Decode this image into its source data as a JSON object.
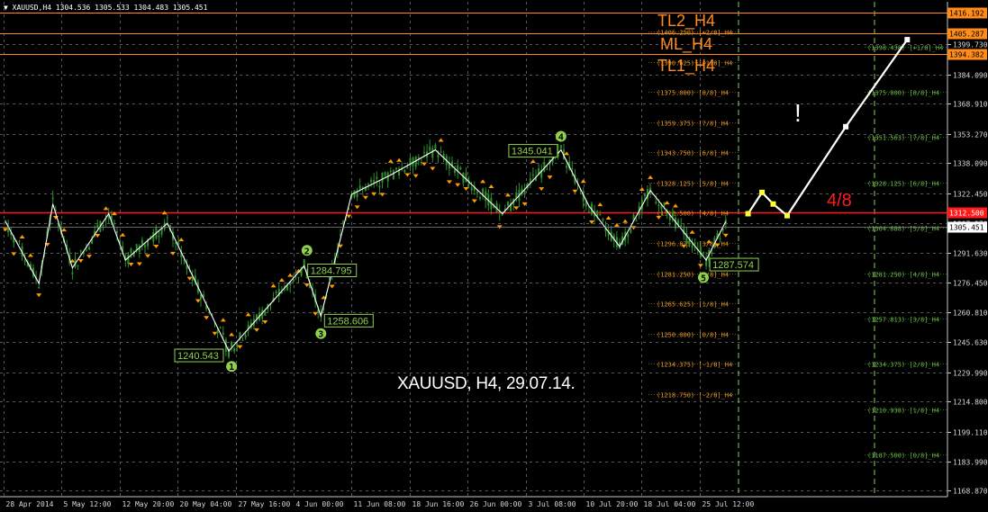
{
  "header": {
    "collapse_glyph": "▼",
    "symbol_line": "XAUUSD,H4  1304.536 1305.533 1304.483 1305.451"
  },
  "caption": "XAUUSD, H4, 29.07.14.",
  "annotations": {
    "exclamation": "!",
    "four_eighths": "4/8",
    "tl2": "TL2_H4",
    "ml": "ML_H4",
    "tl1": "TL1_H4"
  },
  "colors": {
    "background": "#000000",
    "grid": "#5a5a5a",
    "candles": "#2f8f2f",
    "zigzag": "#ffffff",
    "fractals": "#ff9900",
    "level_red": "#ff1a1a",
    "level_orange": "#ff8c1a",
    "wave_labels": "#8fd14f",
    "murrey_orange": "#e89a2a",
    "murrey_green": "#6abf47"
  },
  "chart_data": {
    "type": "candlestick",
    "symbol": "XAUUSD",
    "timeframe": "H4",
    "ylim": [
      1164.0,
      1420.0
    ],
    "price_ticks": [
      1168.87,
      1183.99,
      1199.11,
      1214.8,
      1229.99,
      1245.63,
      1260.81,
      1276.45,
      1291.63,
      1307.27,
      1322.45,
      1338.09,
      1353.27,
      1368.91,
      1384.09,
      1399.73
    ],
    "time_labels": [
      "28 Apr 2014",
      "5 May 12:00",
      "12 May 20:00",
      "20 May 04:00",
      "27 May 16:00",
      "4 Jun 00:00",
      "11 Jun 08:00",
      "18 Jun 16:00",
      "26 Jun 00:00",
      "3 Jul 08:00",
      "10 Jul 20:00",
      "18 Jul 04:00",
      "25 Jul 12:00"
    ],
    "current_price": {
      "value": 1305.451,
      "label": "1305.451"
    },
    "horizontal_levels": [
      {
        "name": "TL2_H4",
        "value": 1416.192,
        "label": "1416.192",
        "color": "#ff8c1a"
      },
      {
        "name": "ML_H4",
        "value": 1405.287,
        "label": "1405.287",
        "color": "#ff8c1a"
      },
      {
        "name": "TL1_H4",
        "value": 1394.382,
        "label": "1394.382",
        "color": "#ff8c1a"
      },
      {
        "name": "4/8",
        "value": 1312.5,
        "label": "1312.500",
        "color": "#ff1a1a"
      }
    ],
    "murrey_orange_levels": [
      {
        "value": 1406.25,
        "label": "(1406.250) [+2/8]_H4"
      },
      {
        "value": 1390.625,
        "label": "(1390.625) [+1/8]_H4"
      },
      {
        "value": 1375.0,
        "label": "(1375.000) [8/8]_H4"
      },
      {
        "value": 1359.375,
        "label": "(1359.375) [7/8]_H4"
      },
      {
        "value": 1343.75,
        "label": "(1343.750) [6/8]_H4"
      },
      {
        "value": 1328.125,
        "label": "(1328.125) [5/8]_H4"
      },
      {
        "value": 1312.5,
        "label": "(1312.500) [4/8]_H4"
      },
      {
        "value": 1296.875,
        "label": "(1296.875) [3/8]_H4"
      },
      {
        "value": 1281.25,
        "label": "(1281.250) [2/8]_H4"
      },
      {
        "value": 1265.625,
        "label": "(1265.625) [1/8]_H4"
      },
      {
        "value": 1250.0,
        "label": "(1250.000) [0/8]_H4"
      },
      {
        "value": 1234.375,
        "label": "(1234.375) [-1/8]_H4"
      },
      {
        "value": 1218.75,
        "label": "(1218.750) [-2/8]_H4"
      }
    ],
    "murrey_green_levels": [
      {
        "value": 1398.438,
        "label": "(1398.438) [+1/8]_H4"
      },
      {
        "value": 1375.0,
        "label": "(1375.000) [8/8]_H4"
      },
      {
        "value": 1351.563,
        "label": "(1351.563) [7/8]_H4"
      },
      {
        "value": 1328.125,
        "label": "(1328.125) [6/8]_H4"
      },
      {
        "value": 1304.688,
        "label": "(1304.688) [5/8]_H4"
      },
      {
        "value": 1281.25,
        "label": "(1281.250) [4/8]_H4"
      },
      {
        "value": 1257.813,
        "label": "(1257.813) [3/8]_H4"
      },
      {
        "value": 1234.375,
        "label": "(1234.375) [2/8]_H4"
      },
      {
        "value": 1210.938,
        "label": "(1210.938) [1/8]_H4"
      },
      {
        "value": 1187.5,
        "label": "(1187.500) [0/8]_H4"
      }
    ],
    "zigzag": [
      {
        "t": 0.0,
        "y": 1308
      },
      {
        "t": 12,
        "y": 1276
      },
      {
        "t": 17,
        "y": 1317
      },
      {
        "t": 24,
        "y": 1284
      },
      {
        "t": 37,
        "y": 1312
      },
      {
        "t": 43,
        "y": 1288
      },
      {
        "t": 58,
        "y": 1307
      },
      {
        "t": 80,
        "y": 1241
      },
      {
        "t": 107,
        "y": 1285
      },
      {
        "t": 113,
        "y": 1259
      },
      {
        "t": 124,
        "y": 1322
      },
      {
        "t": 138,
        "y": 1332
      },
      {
        "t": 154,
        "y": 1345
      },
      {
        "t": 178,
        "y": 1312
      },
      {
        "t": 199,
        "y": 1345
      },
      {
        "t": 209,
        "y": 1316
      },
      {
        "t": 220,
        "y": 1295
      },
      {
        "t": 231,
        "y": 1324
      },
      {
        "t": 251,
        "y": 1288
      },
      {
        "t": 258,
        "y": 1308
      }
    ],
    "price_labels": [
      {
        "t": 80,
        "y": 1241,
        "label": "1240.543"
      },
      {
        "t": 107,
        "y": 1285,
        "label": "1284.795"
      },
      {
        "t": 113,
        "y": 1259,
        "label": "1258.606"
      },
      {
        "t": 199,
        "y": 1345,
        "label": "1345.041"
      },
      {
        "t": 251,
        "y": 1288,
        "label": "1287.574"
      }
    ],
    "wave_points": [
      {
        "t": 81,
        "y": 1233,
        "label": "1"
      },
      {
        "t": 108,
        "y": 1293,
        "label": "2"
      },
      {
        "t": 113,
        "y": 1250,
        "label": "3"
      },
      {
        "t": 199,
        "y": 1352,
        "label": "4"
      },
      {
        "t": 250,
        "y": 1279,
        "label": "5"
      }
    ],
    "projection": [
      {
        "t": 266,
        "y": 1312
      },
      {
        "t": 271,
        "y": 1323
      },
      {
        "t": 275,
        "y": 1317
      },
      {
        "t": 280,
        "y": 1311
      },
      {
        "t": 301,
        "y": 1357
      },
      {
        "t": 323,
        "y": 1402
      }
    ]
  }
}
